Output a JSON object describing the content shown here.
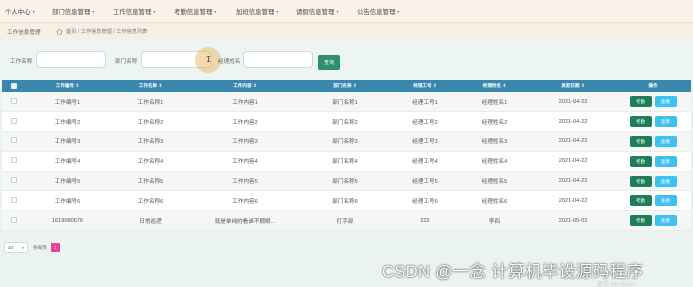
{
  "nav": {
    "items": [
      {
        "label": "个人中心"
      },
      {
        "label": "部门信息管理"
      },
      {
        "label": "工作信息管理"
      },
      {
        "label": "考勤信息管理"
      },
      {
        "label": "加班信息管理"
      },
      {
        "label": "请假信息管理"
      },
      {
        "label": "公告信息管理"
      }
    ],
    "caret": "▾"
  },
  "breadcrumb": {
    "title": "工作信息管理",
    "path": "首页 / 工作信息管理 / 工作信息列表"
  },
  "search": {
    "fields": [
      {
        "label": "工作名称",
        "value": "",
        "placeholder": ""
      },
      {
        "label": "部门名称",
        "value": "",
        "placeholder": ""
      },
      {
        "label": "经理姓名",
        "value": "",
        "placeholder": ""
      }
    ],
    "button_label": "查询",
    "cursor": "I"
  },
  "table": {
    "columns": [
      "",
      "工作编号 ⇕",
      "工作名称 ⇕",
      "工作内容 ⇕",
      "部门名称 ⇕",
      "经理工号 ⇕",
      "经理姓名 ⇕",
      "发起日期 ⇕",
      "操作"
    ],
    "rows": [
      {
        "cells": [
          "工作编号1",
          "工作名称1",
          "工作内容1",
          "部门名称1",
          "经理工号1",
          "经理姓名1",
          "2021-04-22"
        ],
        "edit": "考勤",
        "view": "查看"
      },
      {
        "cells": [
          "工作编号2",
          "工作名称2",
          "工作内容2",
          "部门名称2",
          "经理工号2",
          "经理姓名2",
          "2021-04-22"
        ],
        "edit": "考勤",
        "view": "查看"
      },
      {
        "cells": [
          "工作编号3",
          "工作名称3",
          "工作内容3",
          "部门名称3",
          "经理工号3",
          "经理姓名3",
          "2021-04-22"
        ],
        "edit": "考勤",
        "view": "查看"
      },
      {
        "cells": [
          "工作编号4",
          "工作名称4",
          "工作内容4",
          "部门名称4",
          "经理工号4",
          "经理姓名4",
          "2021-04-22"
        ],
        "edit": "考勤",
        "view": "查看"
      },
      {
        "cells": [
          "工作编号5",
          "工作名称5",
          "工作内容5",
          "部门名称5",
          "经理工号5",
          "经理姓名5",
          "2021-04-22"
        ],
        "edit": "考勤",
        "view": "查看"
      },
      {
        "cells": [
          "工作编号6",
          "工作名称6",
          "工作内容6",
          "部门名称6",
          "经理工号6",
          "经理姓名6",
          "2021-04-22"
        ],
        "edit": "考勤",
        "view": "查看"
      },
      {
        "cells": [
          "1619080676",
          "日常巡逻",
          "就是单纯的看谁不顺眼...",
          "打手部",
          "222",
          "李四",
          "2021-05-02"
        ],
        "edit": "考勤",
        "view": "查看"
      }
    ]
  },
  "pager": {
    "page_size": "10",
    "per_page_label": "条每页",
    "current_page": "1"
  },
  "overlay": {
    "watermark": "CSDN @一念 计算机毕设源码程序",
    "activate": "激活 Windows"
  },
  "colors": {
    "accent": "#3a87ad",
    "primary_button": "#1e7e5c",
    "view_button": "#3ec1f0",
    "page_active": "#ef3f92",
    "focus_highlight": "#e9ba6e"
  }
}
